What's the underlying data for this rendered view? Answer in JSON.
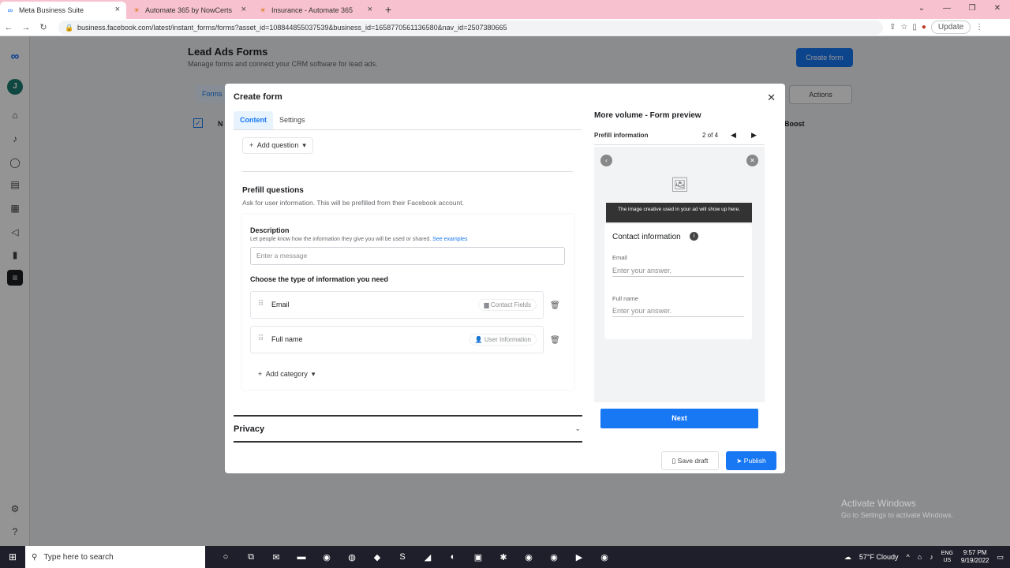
{
  "browser": {
    "tabs": [
      {
        "label": "Meta Business Suite",
        "favicon": "∞",
        "active": true
      },
      {
        "label": "Automate 365 by NowCerts",
        "favicon": "☀",
        "active": false
      },
      {
        "label": "Insurance - Automate 365",
        "favicon": "☀",
        "active": false
      }
    ],
    "url": "business.facebook.com/latest/instant_forms/forms?asset_id=108844855037539&business_id=1658770561136580&nav_id=2507380665",
    "update_label": "Update"
  },
  "page": {
    "title": "Lead Ads Forms",
    "subtitle": "Manage forms and connect your CRM software for lead ads.",
    "create_form_label": "Create form",
    "forms_tab": "Forms",
    "actions_label": "Actions",
    "col_n": "N",
    "col_boost": "Boost"
  },
  "modal": {
    "title": "Create form",
    "tabs": [
      "Content",
      "Settings"
    ],
    "add_question": "Add question",
    "prefill_title": "Prefill questions",
    "prefill_sub": "Ask for user information. This will be prefilled from their Facebook account.",
    "description_label": "Description",
    "description_help": "Let people know how the information they give you will be used or shared.",
    "see_examples": "See examples",
    "description_placeholder": "Enter a message",
    "choose_label": "Choose the type of information you need",
    "fields": [
      {
        "name": "Email",
        "tag": "Contact Fields"
      },
      {
        "name": "Full name",
        "tag": "User Information"
      }
    ],
    "add_category": "Add category",
    "privacy": "Privacy",
    "save_draft": "Save draft",
    "publish": "Publish"
  },
  "preview": {
    "title": "More volume - Form preview",
    "section": "Prefill information",
    "page": "2 of 4",
    "banner": "The image creative used in your ad will show up here.",
    "card_title": "Contact information",
    "fields": [
      {
        "label": "Email",
        "placeholder": "Enter your answer."
      },
      {
        "label": "Full name",
        "placeholder": "Enter your answer."
      }
    ],
    "next_label": "Next"
  },
  "watermark": {
    "title": "Activate Windows",
    "sub": "Go to Settings to activate Windows."
  },
  "taskbar": {
    "search_placeholder": "Type here to search",
    "weather": "57°F  Cloudy",
    "lang_top": "ENG",
    "lang_bottom": "US",
    "time": "9:57 PM",
    "date": "9/19/2022"
  }
}
